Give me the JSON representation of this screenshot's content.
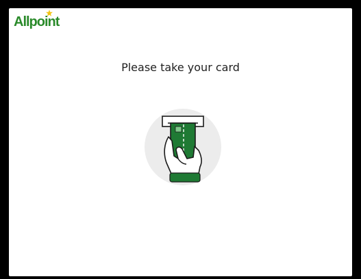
{
  "brand": {
    "name": "Allpoint",
    "color": "#2a8a2a",
    "accent": "#f2c40f"
  },
  "message": "Please take your card",
  "illustration": {
    "icon": "hand-taking-card-icon",
    "card_color": "#1f7a34",
    "circle_color": "#ececec"
  }
}
